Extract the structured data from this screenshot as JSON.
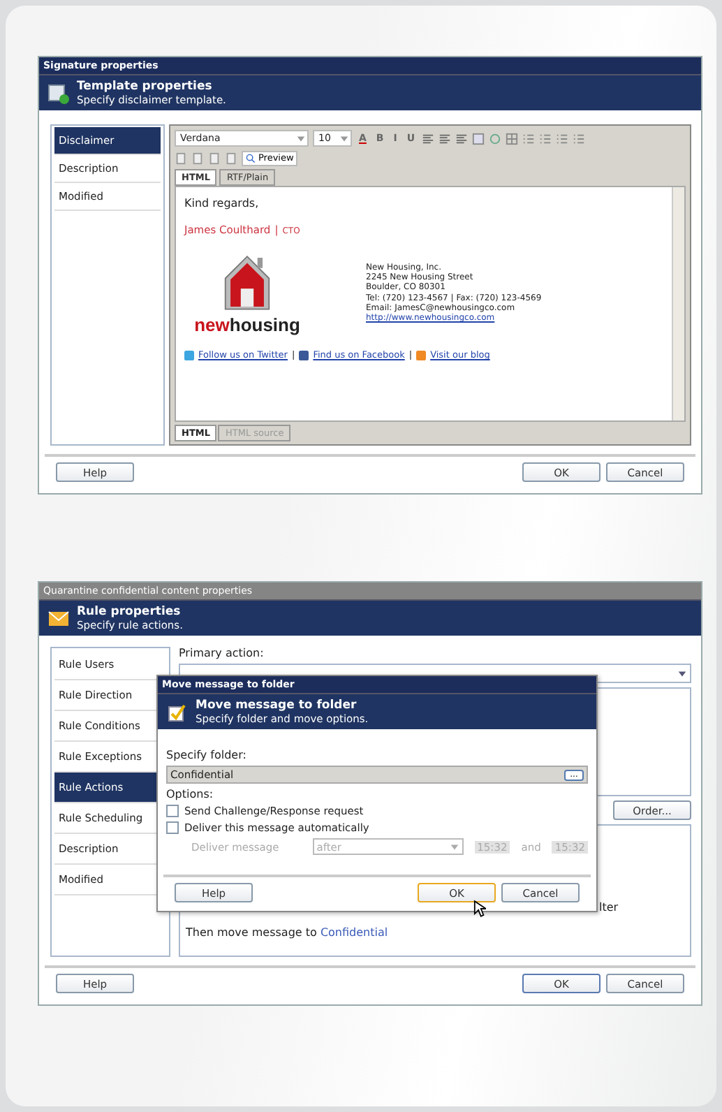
{
  "signature_dialog": {
    "title": "Signature properties",
    "header": {
      "title": "Template properties",
      "subtitle": "Specify disclaimer template."
    },
    "sidebar": {
      "items": [
        {
          "label": "Disclaimer",
          "selected": true
        },
        {
          "label": "Description",
          "selected": false
        },
        {
          "label": "Modified",
          "selected": false
        }
      ]
    },
    "editor": {
      "font": "Verdana",
      "size": "10",
      "font_color_glyph": "A",
      "format_buttons": [
        "B",
        "I",
        "U"
      ],
      "preview_button": "Preview",
      "tabs": [
        {
          "label": "HTML",
          "selected": true
        },
        {
          "label": "RTF/Plain",
          "selected": false
        }
      ],
      "greeting": "Kind regards,",
      "signature_name": "James Coulthard",
      "separator": "|",
      "signature_role": "CTO",
      "logo": {
        "prefix": "new",
        "suffix": "housing"
      },
      "address_lines": [
        "New Housing, Inc.",
        "2245 New Housing Street",
        "Boulder, CO 80301",
        "Tel: (720) 123-4567 | Fax: (720) 123-4569",
        "Email: JamesC@newhousingco.com"
      ],
      "website": "http://www.newhousingco.com",
      "social": [
        {
          "kind": "twitter",
          "label": "Follow us on Twitter"
        },
        {
          "kind": "facebook",
          "label": "Find us on Facebook"
        },
        {
          "kind": "blog",
          "label": "Visit our blog"
        }
      ],
      "social_separator": "|",
      "view_tabs": [
        {
          "label": "HTML",
          "selected": true
        },
        {
          "label": "HTML source",
          "selected": false
        }
      ]
    },
    "buttons": {
      "help": "Help",
      "ok": "OK",
      "cancel": "Cancel"
    }
  },
  "rule_dialog": {
    "title": "Quarantine confidential content properties",
    "header": {
      "title": "Rule properties",
      "subtitle": "Specify rule actions."
    },
    "sidebar": {
      "items": [
        {
          "label": "Rule Users",
          "selected": false
        },
        {
          "label": "Rule Direction",
          "selected": false
        },
        {
          "label": "Rule Conditions",
          "selected": false
        },
        {
          "label": "Rule Exceptions",
          "selected": false
        },
        {
          "label": "Rule Actions",
          "selected": true
        },
        {
          "label": "Rule Scheduling",
          "selected": false
        },
        {
          "label": "Description",
          "selected": false
        },
        {
          "label": "Modified",
          "selected": false
        }
      ]
    },
    "primary_action_label": "Primary action:",
    "order_button": "Order...",
    "description": {
      "fragment": "lter",
      "line_prefix": "Then move message to",
      "line_link": "Confidential"
    },
    "buttons": {
      "help": "Help",
      "ok": "OK",
      "cancel": "Cancel"
    }
  },
  "move_dialog": {
    "title": "Move message to folder",
    "header": {
      "title": "Move message to folder",
      "subtitle": "Specify folder and move options."
    },
    "folder_label": "Specify folder:",
    "folder_value": "Confidential",
    "browse_button": "...",
    "options_label": "Options:",
    "options": [
      {
        "label": "Send Challenge/Response request",
        "checked": false
      },
      {
        "label": "Deliver this message automatically",
        "checked": false
      }
    ],
    "deliver": {
      "label": "Deliver message",
      "disabled": true,
      "mode": "after",
      "time_from": "15:32",
      "and": "and",
      "time_to": "15:32"
    },
    "buttons": {
      "help": "Help",
      "ok": "OK",
      "cancel": "Cancel"
    }
  }
}
